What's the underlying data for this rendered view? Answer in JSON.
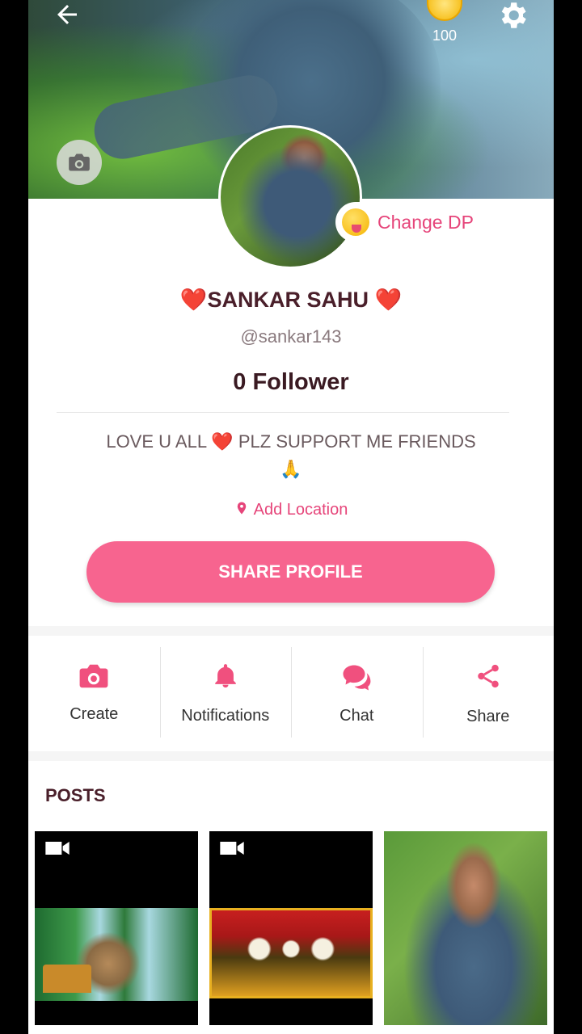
{
  "colors": {
    "accent": "#f7648f",
    "accent_text": "#e6457a",
    "name": "#4a1f2a",
    "heart": "#e01b2d"
  },
  "header": {
    "coins": "100"
  },
  "profile": {
    "heart": "❤️",
    "name": "SANKAR SAHU",
    "handle": "@sankar143",
    "followers": "0 Follower",
    "bio_line1": "LOVE U ALL ❤️ PLZ SUPPORT ME FRIENDS",
    "bio_line2": "🙏",
    "change_dp": "Change DP",
    "location": "Add Location",
    "share_button": "SHARE PROFILE"
  },
  "actions": [
    {
      "label": "Create",
      "icon": "camera-icon"
    },
    {
      "label": "Notifications",
      "icon": "bell-icon"
    },
    {
      "label": "Chat",
      "icon": "chat-icon"
    },
    {
      "label": "Share",
      "icon": "share-icon"
    }
  ],
  "posts": {
    "title": "POSTS",
    "items": [
      {
        "type": "video"
      },
      {
        "type": "video"
      },
      {
        "type": "image"
      }
    ]
  }
}
